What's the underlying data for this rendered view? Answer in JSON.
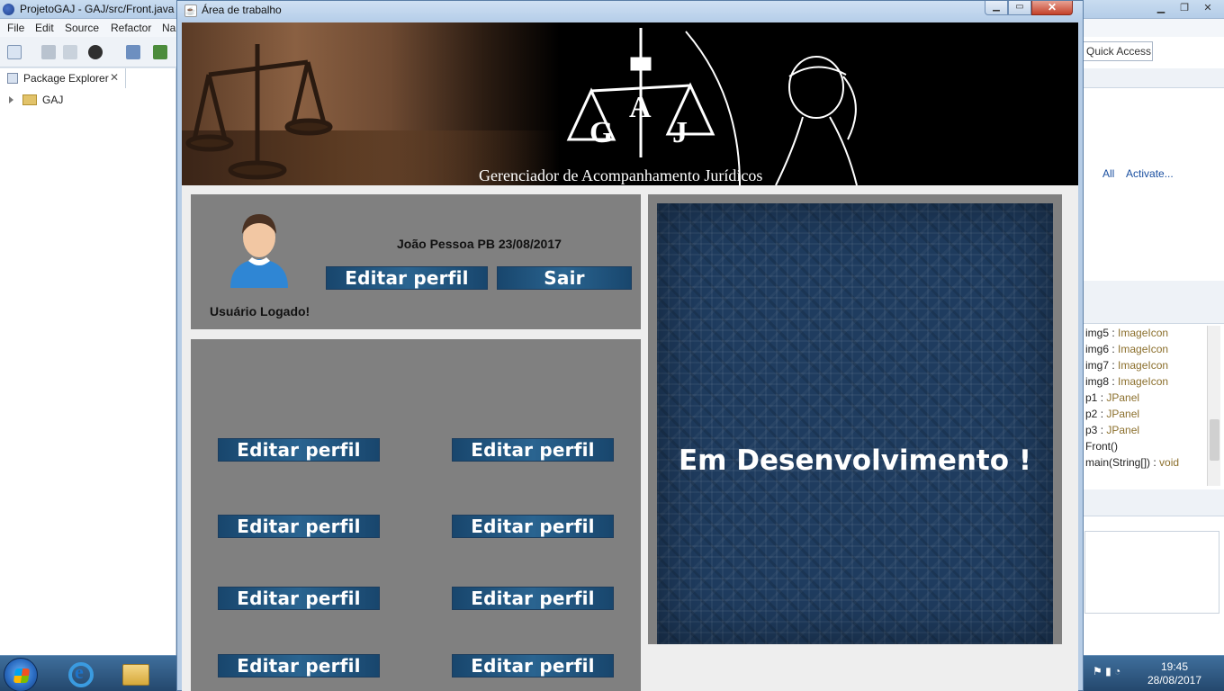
{
  "eclipse": {
    "title": "ProjetoGAJ - GAJ/src/Front.java",
    "menu": [
      "File",
      "Edit",
      "Source",
      "Refactor",
      "Na"
    ],
    "quick_access": "Quick Access",
    "package_explorer": {
      "tab_label": "Package Explorer",
      "close_glyph": "✕",
      "project": "GAJ"
    },
    "task_links": [
      "All",
      "Activate..."
    ],
    "outline": [
      {
        "name": "img5",
        "type": "ImageIcon"
      },
      {
        "name": "img6",
        "type": "ImageIcon"
      },
      {
        "name": "img7",
        "type": "ImageIcon"
      },
      {
        "name": "img8",
        "type": "ImageIcon"
      },
      {
        "name": "p1",
        "type": "JPanel"
      },
      {
        "name": "p2",
        "type": "JPanel"
      },
      {
        "name": "p3",
        "type": "JPanel"
      },
      {
        "name": "Front()",
        "type": ""
      },
      {
        "name": "main(String[])",
        "type": "void"
      }
    ]
  },
  "app": {
    "window_title": "Área de trabalho",
    "banner": {
      "letters": [
        "G",
        "A",
        "J"
      ],
      "tagline": "Gerenciador de Acompanhamento Jurídicos"
    },
    "user_panel": {
      "location_date": "João Pessoa PB 23/08/2017",
      "logged_label": "Usuário Logado!",
      "edit_profile_button": "Editar perfil",
      "exit_button": "Sair"
    },
    "grid_buttons": [
      "Editar perfil",
      "Editar perfil",
      "Editar perfil",
      "Editar perfil",
      "Editar perfil",
      "Editar perfil",
      "Editar perfil",
      "Editar perfil"
    ],
    "dev_message": "Em Desenvolvimento !"
  },
  "taskbar": {
    "time": "19:45",
    "date": "28/08/2017"
  },
  "colors": {
    "panel_gray": "#808080",
    "button_blue": "#1f5580",
    "dev_panel_blue": "#1f3c5f"
  }
}
